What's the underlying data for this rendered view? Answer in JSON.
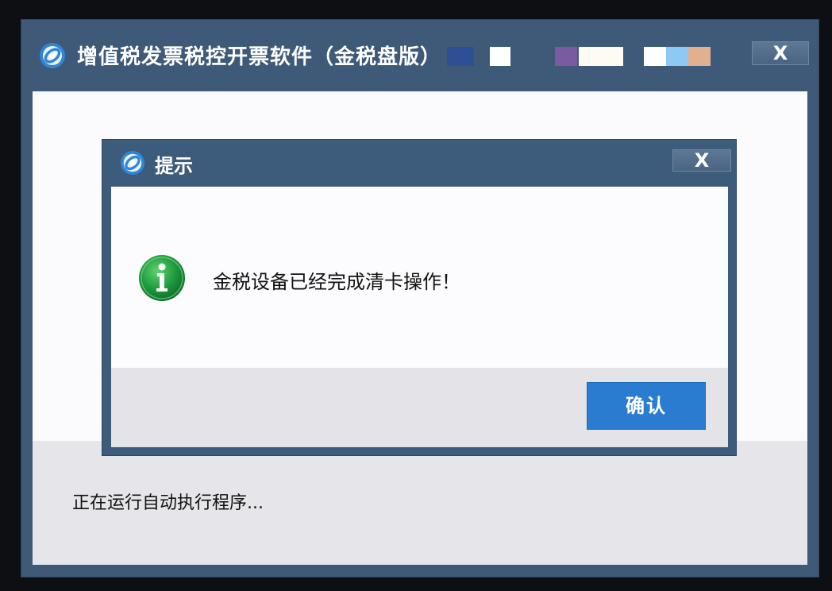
{
  "main_window": {
    "title": "增值税发票税控开票软件（金税盘版）",
    "close_label": "X",
    "status_text": "正在运行自动执行程序..."
  },
  "dialog": {
    "title": "提示",
    "close_label": "X",
    "message": "金税设备已经完成清卡操作！",
    "ok_label": "确认",
    "icon": "info-icon"
  },
  "colors": {
    "titlebar": "#3e5a78",
    "button_primary": "#2a7cd0",
    "info_icon": "#1e9a3e"
  }
}
